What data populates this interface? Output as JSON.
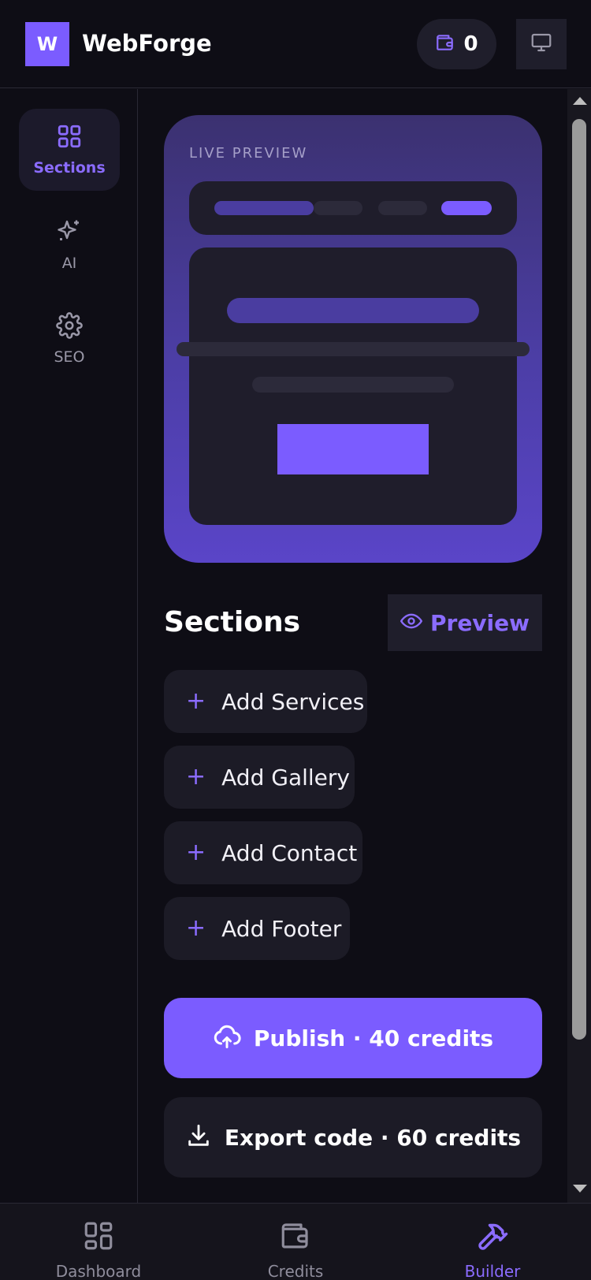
{
  "header": {
    "logo_letter": "W",
    "brand": "WebForge",
    "wallet_balance": "0"
  },
  "rail": {
    "items": [
      {
        "label": "Sections",
        "icon": "grid-icon",
        "active": true
      },
      {
        "label": "AI",
        "icon": "sparkle-icon",
        "active": false
      },
      {
        "label": "SEO",
        "icon": "gear-icon",
        "active": false
      }
    ]
  },
  "preview": {
    "label": "LIVE PREVIEW"
  },
  "sections": {
    "title": "Sections",
    "preview_button": "Preview",
    "add_buttons": [
      "Add Services",
      "Add Gallery",
      "Add Contact",
      "Add Footer"
    ]
  },
  "actions": {
    "publish": "Publish · 40 credits",
    "export": "Export code · 60 credits"
  },
  "bottom_nav": {
    "items": [
      {
        "label": "Dashboard",
        "icon": "dashboard-icon",
        "active": false
      },
      {
        "label": "Credits",
        "icon": "wallet-icon",
        "active": false
      },
      {
        "label": "Builder",
        "icon": "hammer-icon",
        "active": true
      }
    ]
  },
  "colors": {
    "accent": "#7b5cff",
    "background": "#0e0d15",
    "surface": "#1c1b26"
  }
}
